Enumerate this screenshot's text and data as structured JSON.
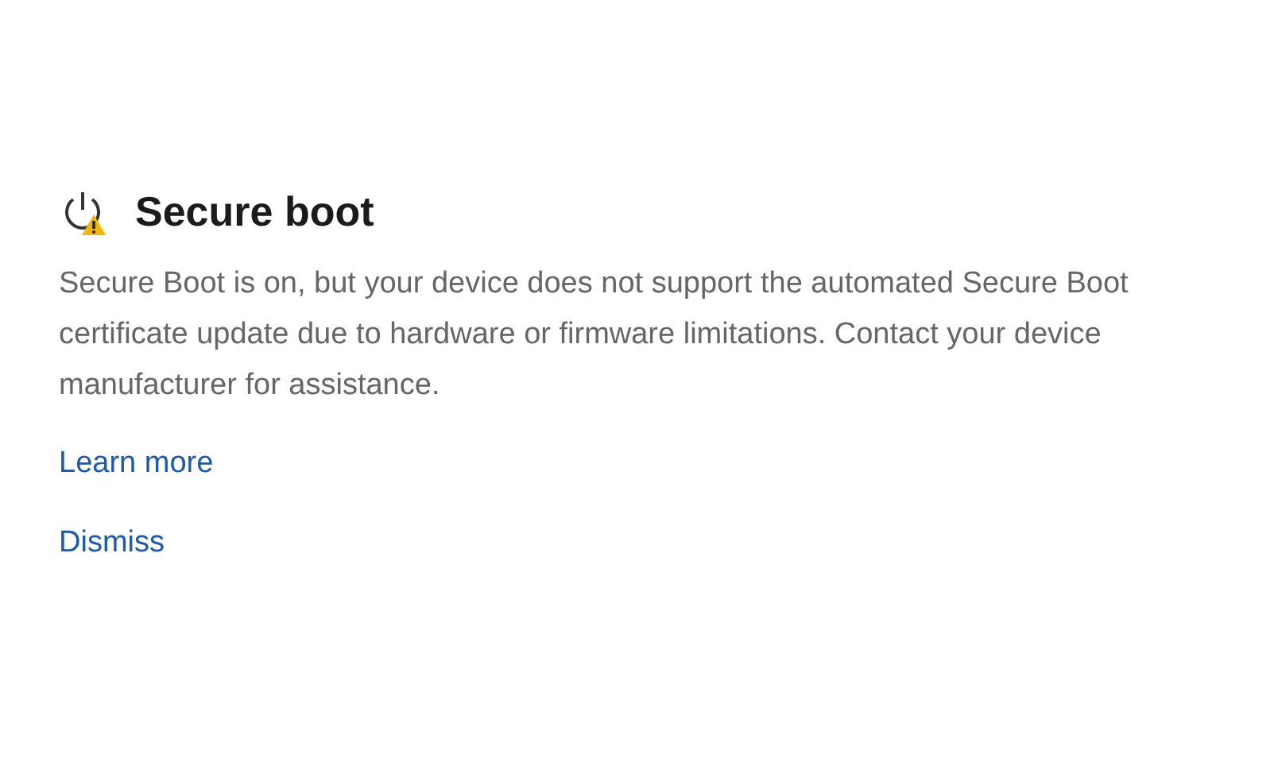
{
  "title": "Secure boot",
  "description": "Secure Boot is on, but your device does not support the automated Secure Boot certificate update due to hardware or firmware limitations. Contact your device manufacturer for assistance.",
  "links": [
    "Learn more",
    "Dismiss"
  ]
}
